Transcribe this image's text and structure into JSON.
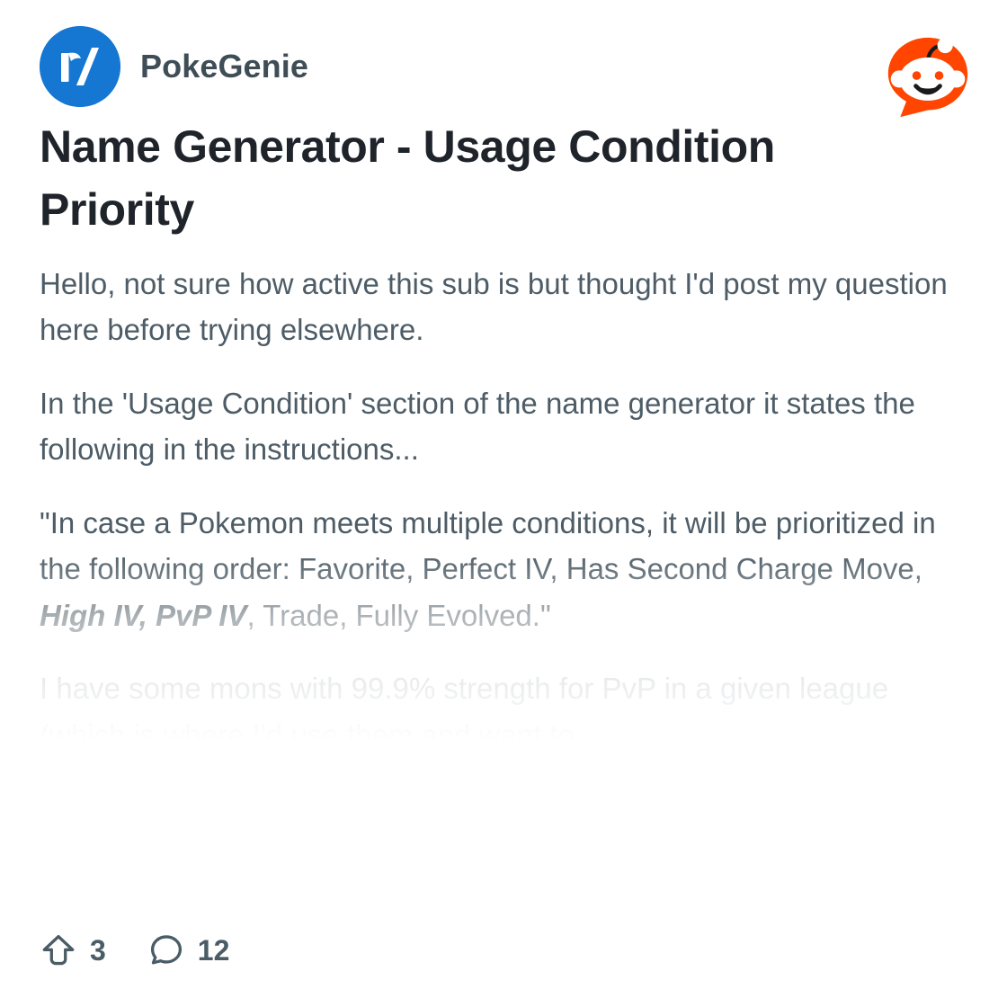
{
  "header": {
    "subreddit": "PokeGenie",
    "avatar_label": "r/",
    "avatar_color": "#1577d2",
    "brand_logo": "reddit-snoo-icon",
    "brand_color": "#ff4500"
  },
  "post": {
    "title": "Name Generator - Usage Condition Priority",
    "title_color": "#1f242b",
    "body_color": "#4d5c66",
    "paragraphs": [
      {
        "id": "p1",
        "text": "Hello, not sure how active this sub is but thought I'd post my question here before trying elsewhere."
      },
      {
        "id": "p2",
        "text": "In the 'Usage Condition' section of the name generator it states the following in the instructions..."
      },
      {
        "id": "p3",
        "lead": "\"In case a Pokemon meets multiple conditions, it will be prioritized in the following order: Favorite, Perfect IV, Has Second Charge Move, ",
        "emphasis": "High IV, PvP IV",
        "tail": ", Trade, Fully Evolved.\""
      },
      {
        "id": "p4",
        "text": "I have some mons with 99.9% strength for PvP in a given league (which is where I'd use them and want to"
      }
    ]
  },
  "footer": {
    "upvote_icon": "upvote-arrow-icon",
    "upvote_count": "3",
    "comment_icon": "comment-bubble-icon",
    "comment_count": "12",
    "icon_color": "#4a5c66"
  }
}
